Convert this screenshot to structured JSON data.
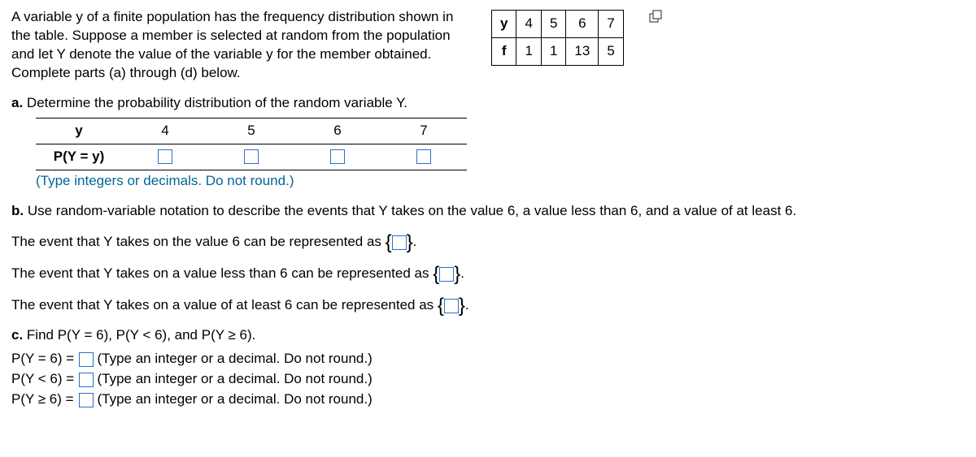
{
  "intro": "A variable y of a finite population has the frequency distribution shown in the table. Suppose a member is selected at random from the population and let Y denote the value of the variable y for the member obtained. Complete parts (a) through (d) below.",
  "freq": {
    "row1_label": "y",
    "row2_label": "f",
    "y": [
      "4",
      "5",
      "6",
      "7"
    ],
    "f": [
      "1",
      "1",
      "13",
      "5"
    ]
  },
  "a": {
    "prompt": "a. Determine the probability distribution of the random variable Y.",
    "row1_label": "y",
    "row2_label": "P(Y = y)",
    "cols": [
      "4",
      "5",
      "6",
      "7"
    ],
    "hint": "(Type integers or decimals. Do not round.)"
  },
  "b": {
    "prompt": "b. Use random-variable notation to describe the events that Y takes on the value 6, a value less than 6, and a value of at least 6.",
    "line1_pre": "The event that Y takes on the value 6 can be represented as ",
    "line2_pre": "The event that Y takes on a value less than 6 can be represented as ",
    "line3_pre": "The event that Y takes on a value of at least 6 can be represented as ",
    "period": "."
  },
  "c": {
    "prompt": "c. Find P(Y = 6), P(Y < 6), and P(Y ≥ 6).",
    "rows": [
      {
        "label": "P(Y = 6) =",
        "hint": "(Type an integer or a decimal. Do not round.)"
      },
      {
        "label": "P(Y < 6) =",
        "hint": "(Type an integer or a decimal. Do not round.)"
      },
      {
        "label": "P(Y ≥ 6) =",
        "hint": "(Type an integer or a decimal. Do not round.)"
      }
    ]
  }
}
